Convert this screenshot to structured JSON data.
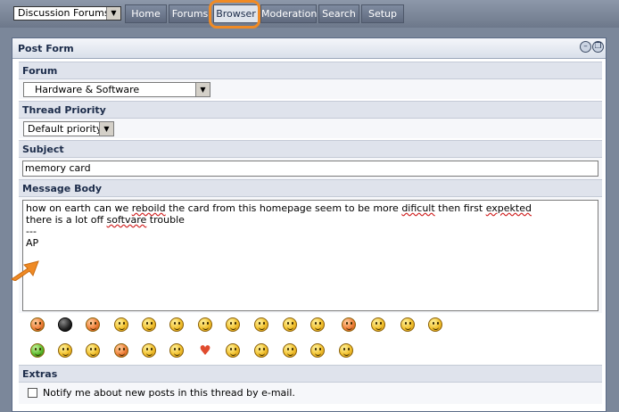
{
  "topbar": {
    "selector_value": "Discussion Forums",
    "tabs": [
      {
        "label": "Home",
        "active": false
      },
      {
        "label": "Forums",
        "active": false
      },
      {
        "label": "Browser",
        "active": true
      },
      {
        "label": "Moderation",
        "active": false
      },
      {
        "label": "Search",
        "active": false
      },
      {
        "label": "Setup",
        "active": false
      }
    ]
  },
  "panel": {
    "title": "Post Form",
    "minimize_icon": "minus-circle-icon",
    "restore_icon": "restore-circle-icon"
  },
  "forum": {
    "label": "Forum",
    "selected": "Hardware & Software"
  },
  "priority": {
    "label": "Thread Priority",
    "selected": "Default priority"
  },
  "subject": {
    "label": "Subject",
    "value": "memory card"
  },
  "message": {
    "label": "Message Body",
    "lines": [
      "how on earth can we reboild the card from this homepage seem to be more dificult then first expekted",
      "there is a lot off softvare trouble",
      "---",
      "AP"
    ]
  },
  "smileys": {
    "row1": [
      "angry-face-icon",
      "bomb-icon",
      "devil-face-icon",
      "sleepy-face-icon",
      "grin-face-icon",
      "thumbs-up-face-icon",
      "shifty-eyes-face-icon",
      "winged-face-icon",
      "thinking-face-icon",
      "surprised-face-icon",
      "evil-grin-face-icon",
      "dancing-devil-icon",
      "tongue-out-face-icon",
      "sunglasses-face-icon",
      "kiss-face-icon"
    ],
    "row2": [
      "sick-face-icon",
      "smoking-face-icon",
      "cool-face-icon",
      "laughing-face-icon",
      "wink-face-icon",
      "nerd-face-icon",
      "heart-icon",
      "magnifier-face-icon",
      "confused-face-icon",
      "sad-face-icon",
      "blushing-face-icon",
      "smile-face-icon"
    ]
  },
  "extras": {
    "label": "Extras",
    "notify_label": "Notify me about new posts in this thread by e-mail.",
    "notify_checked": false
  },
  "colors": {
    "accent_ring": "#f08a24",
    "header_text": "#1c2c4a"
  }
}
